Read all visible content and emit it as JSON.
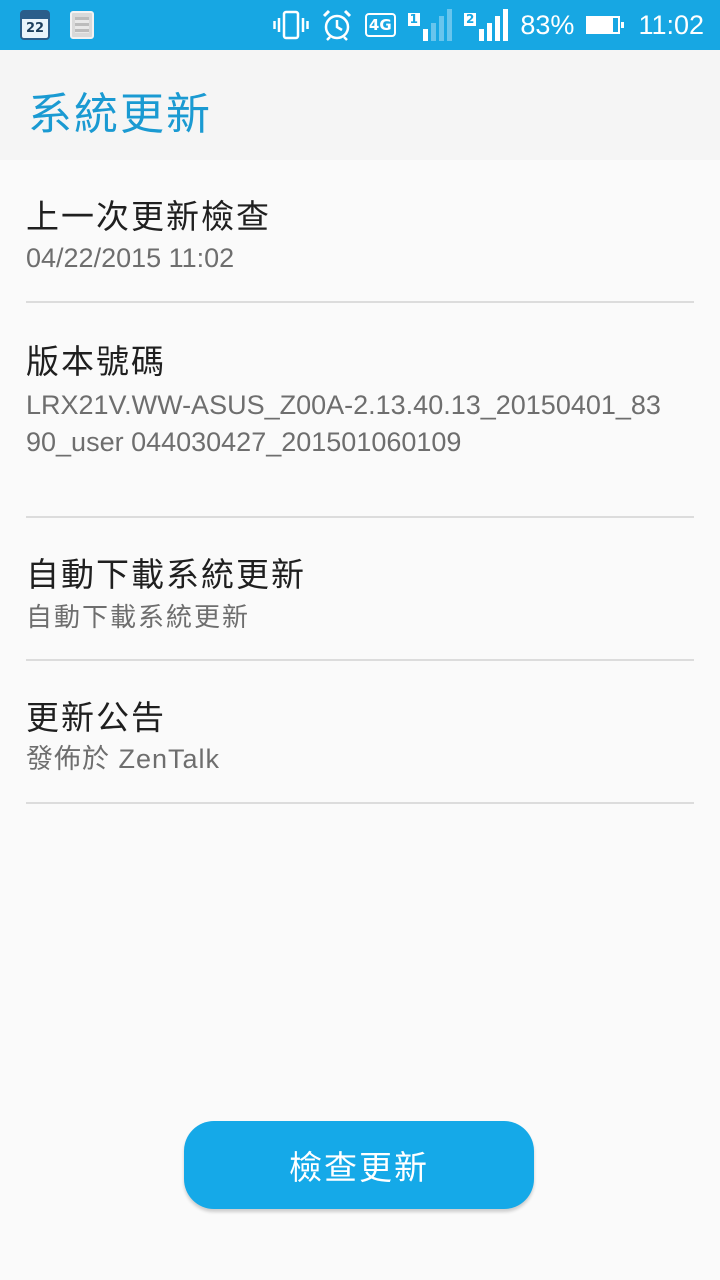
{
  "status_bar": {
    "calendar_day": "22",
    "network_type": "4G",
    "sim1_label": "1",
    "sim2_label": "2",
    "battery_percent": "83%",
    "time": "11:02",
    "icons": [
      "calendar-icon",
      "gallery-icon",
      "vibrate-icon",
      "alarm-icon",
      "4g-icon",
      "signal-sim1-icon",
      "signal-sim2-icon",
      "battery-icon"
    ]
  },
  "header": {
    "title": "系統更新"
  },
  "items": [
    {
      "title": "上一次更新檢查",
      "subtitle": "04/22/2015 11:02"
    },
    {
      "title": "版本號碼",
      "subtitle": "LRX21V.WW-ASUS_Z00A-2.13.40.13_20150401_8390_user 044030427_201501060109"
    },
    {
      "title": "自動下載系統更新",
      "subtitle": "自動下載系統更新"
    },
    {
      "title": "更新公告",
      "subtitle": "發佈於 ZenTalk"
    }
  ],
  "check_button": {
    "label": "檢查更新"
  },
  "colors": {
    "status_bar": "#17a7e3",
    "title": "#1a9ad2",
    "button": "#15a9e8"
  }
}
